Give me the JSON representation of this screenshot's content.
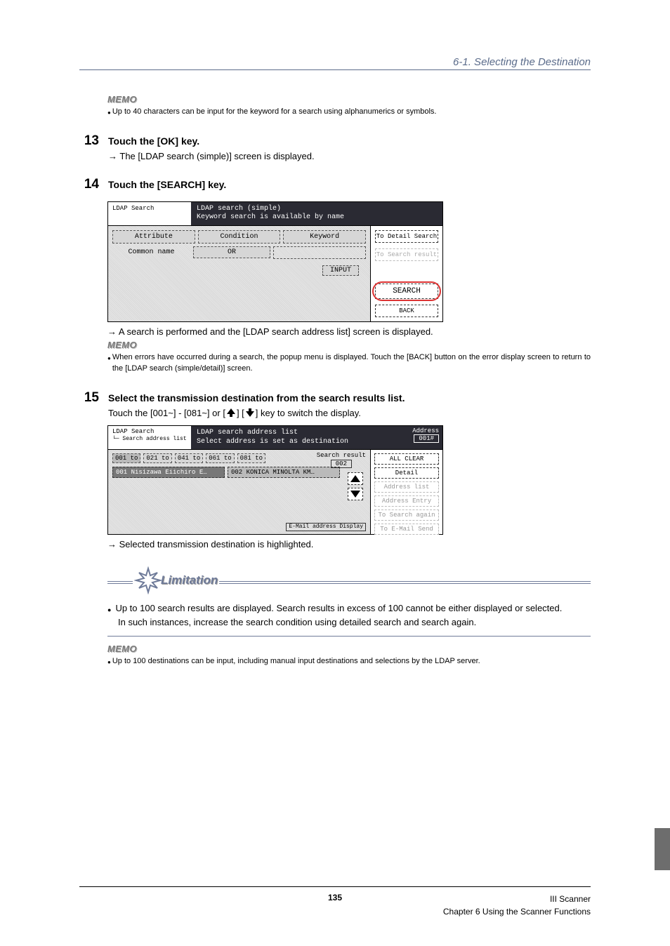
{
  "header": {
    "section": "6-1. Selecting the Destination"
  },
  "memo1": {
    "label": "MEMO",
    "text": "Up to 40 characters can be input for the keyword for a search using alphanumerics or symbols."
  },
  "step13": {
    "num": "13",
    "title": "Touch the [OK] key.",
    "result": "The [LDAP search (simple)] screen is displayed."
  },
  "step14": {
    "num": "14",
    "title": "Touch the [SEARCH] key.",
    "result": "A search is performed and the [LDAP search address list] screen is displayed."
  },
  "memo2": {
    "label": "MEMO",
    "text": "When errors have occurred during a search, the popup menu is displayed. Touch the [BACK] button on the error display screen to return to the [LDAP search (simple/detail)] screen."
  },
  "step15": {
    "num": "15",
    "title": "Select the transmission destination from the search results list.",
    "body_prefix": "Touch the [001~] - [081~] or [",
    "body_mid": "] [",
    "body_suffix": "] key to switch the display.",
    "result": "Selected transmission destination is highlighted."
  },
  "screenshot1": {
    "top_left": "LDAP Search",
    "top_mid_line1": "LDAP search (simple)",
    "top_mid_line2": "Keyword search is available by name",
    "hdr_attribute": "Attribute",
    "hdr_condition": "Condition",
    "hdr_keyword": "Keyword",
    "row_attr": "Common name",
    "row_cond": "OR",
    "input_btn": "INPUT",
    "side_detail": "To Detail Search",
    "side_result": "To Search result",
    "side_search": "SEARCH",
    "side_back": "BACK"
  },
  "screenshot2": {
    "top_left_line1": "LDAP Search",
    "top_left_line2": "└─ Search address list",
    "top_mid_line1": "LDAP search address list",
    "top_mid_line2": "Select address is set as destination",
    "top_right_label": "Address",
    "top_right_box": "001#",
    "tabs": [
      "001 to",
      "021 to",
      "041 to",
      "061 to",
      "081 to"
    ],
    "search_result_label": "Search result",
    "search_result_val": "002",
    "items": [
      "001 Nisizawa Eiichiro E…",
      "002 KONICA MINOLTA KM…"
    ],
    "mail_label": "E-Mail address Display",
    "side": {
      "all_clear": "ALL CLEAR",
      "detail": "Detail",
      "addr_list": "Address list",
      "addr_entry": "Address Entry",
      "search_again": "To Search again",
      "email_send": "To E-Mail Send"
    }
  },
  "limitation": {
    "label": "Limitation",
    "bullet1": "Up to 100 search results are displayed. Search results in excess of 100 cannot be either displayed or selected.",
    "bullet1_sub": "In such instances, increase the search condition using detailed search and search again."
  },
  "memo3": {
    "label": "MEMO",
    "text": "Up to 100 destinations can be input, including manual input destinations and selections by the LDAP server."
  },
  "footer": {
    "page": "135",
    "right1": "III Scanner",
    "right2": "Chapter 6 Using the Scanner Functions"
  }
}
